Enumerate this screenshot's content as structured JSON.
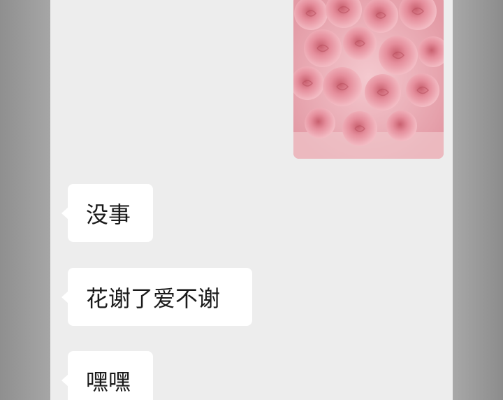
{
  "messages": [
    {
      "type": "image",
      "direction": "sent",
      "icon": "rose-bouquet-photo"
    },
    {
      "type": "text",
      "direction": "received",
      "text": "没事"
    },
    {
      "type": "text",
      "direction": "received",
      "text": "花谢了爱不谢"
    },
    {
      "type": "text",
      "direction": "received",
      "text": "嘿嘿"
    }
  ],
  "colors": {
    "chat_background": "#ededed",
    "bubble_received": "#ffffff",
    "text": "#1a1a1a",
    "photo_pink": "#e8a4ac"
  }
}
